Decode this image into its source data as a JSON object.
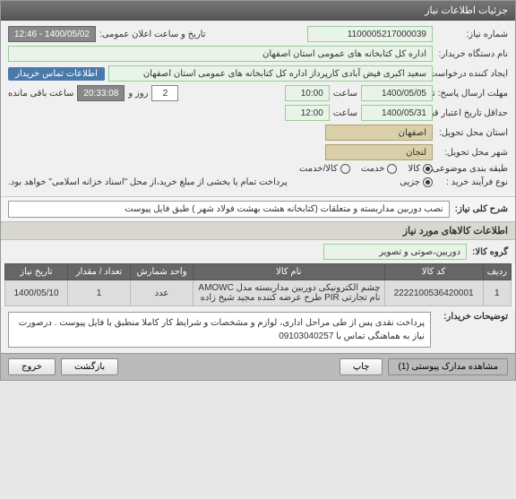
{
  "header": {
    "title": "جزئیات اطلاعات نیاز"
  },
  "form": {
    "need_number_label": "شماره نیاز:",
    "need_number": "1100005217000039",
    "announce_label": "تاریخ و ساعت اعلان عمومی:",
    "announce_value": "1400/05/02 - 12:46",
    "buyer_label": "نام دستگاه خریدار:",
    "buyer_value": "اداره کل کتابخانه های عمومی استان اصفهان",
    "requester_label": "ایجاد کننده درخواست:",
    "requester_value": "سعید اکبری فیض آبادی کارپرداز اداره کل کتابخانه های عمومی استان اصفهان",
    "contact_badge": "اطلاعات تماس خریدار",
    "deadline_label": "مهلت ارسال پاسخ: تا تاریخ:",
    "deadline_date": "1400/05/05",
    "time_label": "ساعت",
    "deadline_time": "10:00",
    "days_count": "2",
    "days_label": "روز و",
    "remaining_time": "20:33:08",
    "remaining_label": "ساعت باقی مانده",
    "validity_label": "حداقل تاریخ اعتبار قیمت: تا تاریخ:",
    "validity_date": "1400/05/31",
    "validity_time": "12:00",
    "province_label": "استان محل تحویل:",
    "province_value": "اصفهان",
    "city_label": "شهر محل تحویل:",
    "city_value": "لنجان",
    "category_label": "طبقه بندی موضوعی:",
    "cat_kala": "کالا",
    "cat_khadamat": "خدمت",
    "cat_combined": "کالا/خدمت",
    "process_label": "نوع فرآیند خرید :",
    "proc_partial": "جزیی",
    "proc_note": "پرداخت تمام یا بخشی از مبلغ خرید،از محل \"اسناد خزانه اسلامی\" خواهد بود."
  },
  "summary": {
    "title": "شرح کلی نیاز:",
    "text": "نصب دوربین مداربسته و متعلقات (کتابخانه هشت بهشت فولاد شهر ) طبق فایل پیوست"
  },
  "items_header": "اطلاعات کالاهای مورد نیاز",
  "group": {
    "label": "گروه کالا:",
    "value": "دوربین،صوتی و تصویر"
  },
  "table": {
    "headers": {
      "row": "ردیف",
      "code": "کد کالا",
      "name": "نام کالا",
      "unit": "واحد شمارش",
      "qty": "تعداد / مقدار",
      "date": "تاریخ نیاز"
    },
    "rows": [
      {
        "row": "1",
        "code": "2222100536420001",
        "name": "چشم الکترونیکی دوربین مداربسته مدل AMOWC نام تجارتی PIR طرح عرضه کننده مجید شیخ زاده",
        "unit": "عدد",
        "qty": "1",
        "date": "1400/05/10"
      }
    ]
  },
  "notes": {
    "label": "توضیحات خریدار:",
    "text": "پرداخت نقدی پس از طی مراحل اداری، لوازم و مشخصات و شرایط کار کاملا منطبق با فایل پیوست . درصورت نیاز به هماهنگی تماس با 09103040257"
  },
  "footer": {
    "attachments": "مشاهده مدارک پیوستی (1)",
    "print": "چاپ",
    "back": "بازگشت",
    "exit": "خروج"
  }
}
